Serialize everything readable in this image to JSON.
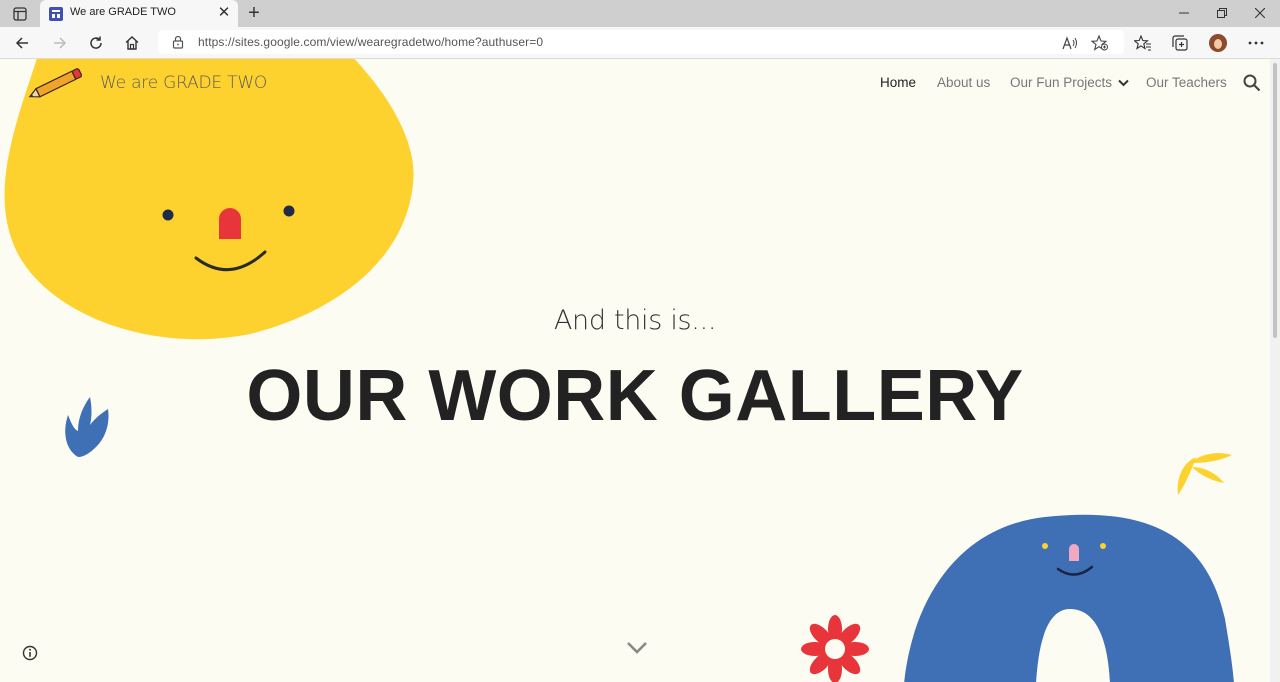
{
  "browser": {
    "tab": {
      "title": "We are GRADE TWO",
      "close_glyph": "✕"
    },
    "new_tab_glyph": "+",
    "url": "https://sites.google.com/view/wearegradetwo/home?authuser=0",
    "window_controls": {
      "minimize": "—",
      "restore": "❐",
      "close": "✕"
    }
  },
  "site": {
    "title": "We are GRADE TWO",
    "nav": [
      {
        "label": "Home",
        "active": true
      },
      {
        "label": "About us",
        "active": false
      },
      {
        "label": "Our Fun Projects",
        "active": false,
        "has_dropdown": true
      },
      {
        "label": "Our Teachers",
        "active": false
      }
    ],
    "hero": {
      "subtitle": "And this is...",
      "headline": "OUR WORK GALLERY"
    }
  },
  "colors": {
    "background": "#fdfcf3",
    "yellow": "#fdd22f",
    "blue": "#3f6fb5",
    "red": "#e8343b",
    "ink": "#222222",
    "pink": "#f2a8c3"
  },
  "icons": [
    "pencil-icon",
    "search-icon",
    "chevron-down-icon",
    "info-icon"
  ]
}
